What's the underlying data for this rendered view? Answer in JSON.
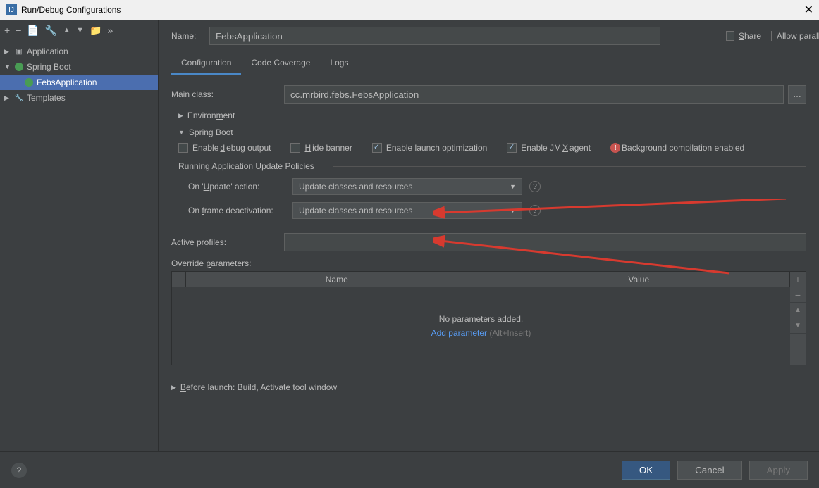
{
  "title": "Run/Debug Configurations",
  "nameLabel": "Name:",
  "nameValue": "FebsApplication",
  "shareLabel": "Share",
  "parallelLabel": "Allow parallel run",
  "tree": {
    "application": "Application",
    "springBoot": "Spring Boot",
    "febsApp": "FebsApplication",
    "templates": "Templates"
  },
  "tabs": {
    "config": "Configuration",
    "coverage": "Code Coverage",
    "logs": "Logs"
  },
  "mainClassLabel": "Main class:",
  "mainClassValue": "cc.mrbird.febs.FebsApplication",
  "environment": "Environment",
  "springBootSection": "Spring Boot",
  "checkboxes": {
    "debug": "Enable debug output",
    "hideBanner": "Hide banner",
    "launchOpt": "Enable launch optimization",
    "jmx": "Enable JMX agent",
    "bgCompile": "Background compilation enabled"
  },
  "policiesLabel": "Running Application Update Policies",
  "onUpdateLabel": "On 'Update' action:",
  "onFrameLabel": "On frame deactivation:",
  "selectValue": "Update classes and resources",
  "activeProfilesLabel": "Active profiles:",
  "overrideLabel": "Override parameters:",
  "tableHeaders": {
    "name": "Name",
    "value": "Value"
  },
  "emptyMsg": "No parameters added.",
  "addParam": "Add parameter",
  "addParamHint": "(Alt+Insert)",
  "beforeLaunch": "Before launch: Build, Activate tool window",
  "buttons": {
    "ok": "OK",
    "cancel": "Cancel",
    "apply": "Apply"
  }
}
